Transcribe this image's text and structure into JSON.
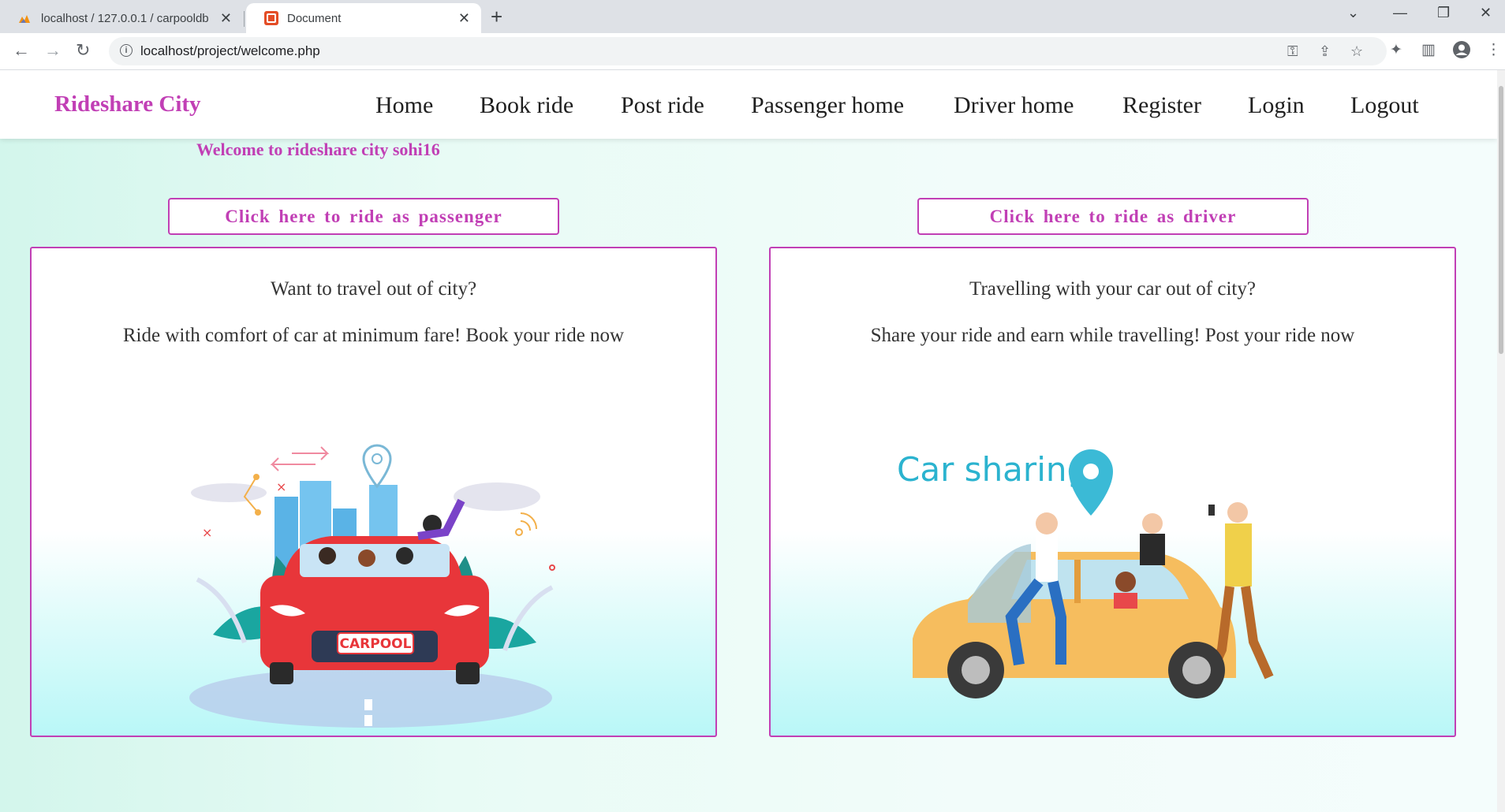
{
  "browser": {
    "tabs": [
      {
        "title": "localhost / 127.0.0.1 / carpooldb",
        "active": false
      },
      {
        "title": "Document",
        "active": true
      }
    ],
    "url": "localhost/project/welcome.php"
  },
  "navbar": {
    "brand": "Rideshare City",
    "items": [
      "Home",
      "Book ride",
      "Post ride",
      "Passenger home",
      "Driver home",
      "Register",
      "Login",
      "Logout"
    ]
  },
  "welcome_text": "Welcome to rideshare city sohi16",
  "passenger": {
    "button": "Click here to ride as passenger",
    "question": "Want to travel out of city?",
    "description": "Ride with comfort of car at minimum fare! Book your ride now",
    "plate_text": "CARPOOL"
  },
  "driver": {
    "button": "Click here to ride as driver",
    "question": "Travelling with your car out of city?",
    "description": "Share your ride and earn while travelling! Post your ride now",
    "illustration_title": "Car sharing"
  },
  "colors": {
    "accent": "#c13fb5",
    "text": "#333333",
    "page_bg": "#e8fbf5"
  }
}
